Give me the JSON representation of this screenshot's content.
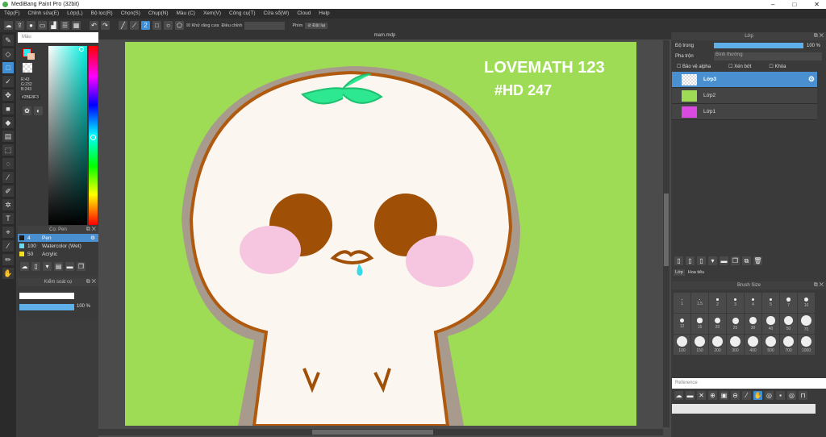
{
  "window": {
    "title": "MediBang Paint Pro (32bit)",
    "min": "–",
    "max": "□",
    "close": "✕"
  },
  "menu": [
    "Tệp(F)",
    "Chỉnh sửa(E)",
    "Lớp(L)",
    "Bộ lọc(R)",
    "Chọn(S)",
    "Chụp(N)",
    "Màu (C)",
    "Xem(V)",
    "Công cụ(T)",
    "Cửa sổ(W)",
    "Cloud",
    "Help"
  ],
  "toolbar": {
    "antialias_label": "Khử răng cưa",
    "correction_label": "Điều chỉnh",
    "snap_label": "Phím",
    "snap_off": "Đặt lại"
  },
  "color_panel": {
    "title": "Màu",
    "rgb": [
      "R:43",
      "G:232",
      "B:243"
    ],
    "hex": "#2BE8F3"
  },
  "brush_panel": {
    "title": "Cọ: Pen",
    "brushes": [
      {
        "size": "4",
        "name": "Pen",
        "color": "#1a1a1a"
      },
      {
        "size": "100",
        "name": "Watercolor (Wet)",
        "color": "#6fd6ef"
      },
      {
        "size": "50",
        "name": "Acrylic",
        "color": "#f0e020"
      }
    ]
  },
  "size_panel": {
    "title": "Kiểm soát cọ",
    "opacity": "100 %",
    "opacity_value": 100
  },
  "document": {
    "tab": "mam.mdp",
    "text1": "LOVEMATH 123",
    "text2": "#HD 247"
  },
  "layers_panel": {
    "title": "Lớp",
    "opacity_label": "Độ trong",
    "opacity": "100 %",
    "opacity_value": 100,
    "blend_label": "Pha trộn",
    "blend": "Bình thường",
    "protect_alpha": "Bảo vệ alpha",
    "clip": "Xén bớt",
    "lock": "Khóa",
    "layers": [
      "Lớp3",
      "Lớp2",
      "Lớp1"
    ],
    "tabs": [
      "Lớp",
      "Hoa tiêu"
    ]
  },
  "brush_size": {
    "title": "Brush Size",
    "sizes": [
      "1",
      "1.5",
      "2",
      "3",
      "4",
      "5",
      "7",
      "10",
      "12",
      "15",
      "20",
      "25",
      "30",
      "40",
      "50",
      "70",
      "100",
      "150",
      "200",
      "300",
      "400",
      "500",
      "700",
      "1000"
    ]
  },
  "reference": {
    "title": "Reference"
  }
}
